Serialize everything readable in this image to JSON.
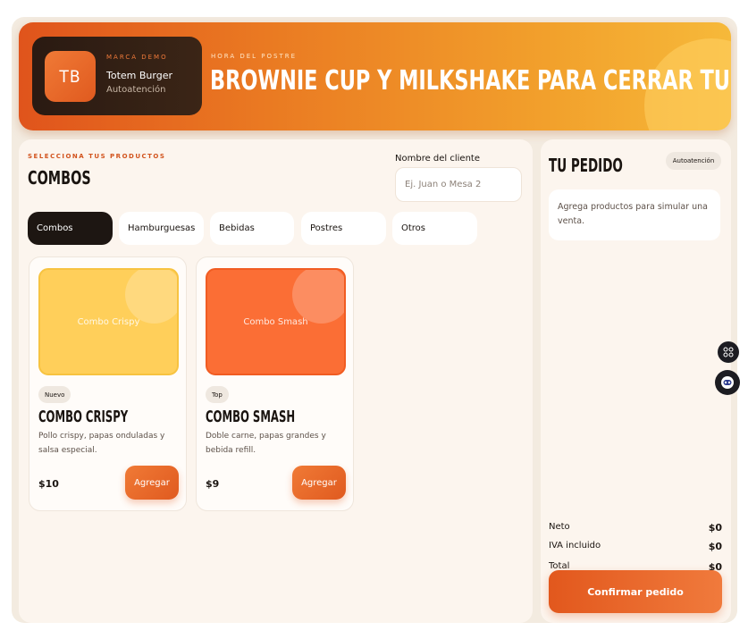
{
  "banner": {
    "brand_eyebrow": "MARCA DEMO",
    "brand_logo": "TB",
    "brand_name": "Totem Burger",
    "brand_sub": "Autoatención",
    "promo_eyebrow": "HORA DEL POSTRE",
    "promo_title": "BROWNIE CUP Y MILKSHAKE PARA CERRAR TU PEDIDO."
  },
  "products": {
    "eyebrow": "SELECCIONA TUS PRODUCTOS",
    "title": "COMBOS",
    "client_label": "Nombre del cliente",
    "client_placeholder": "Ej. Juan o Mesa 2",
    "tabs": [
      "Combos",
      "Hamburguesas",
      "Bebidas",
      "Postres",
      "Otros"
    ],
    "items": [
      {
        "image_label": "Combo Crispy",
        "badge": "Nuevo",
        "name": "COMBO CRISPY",
        "description": "Pollo crispy, papas onduladas y salsa especial.",
        "price": "$10",
        "button": "Agregar",
        "color": "#ffcf5a"
      },
      {
        "image_label": "Combo Smash",
        "badge": "Top",
        "name": "COMBO SMASH",
        "description": "Doble carne, papas grandes y bebida refill.",
        "price": "$9",
        "button": "Agregar",
        "color": "#fb6e35"
      }
    ]
  },
  "order": {
    "title": "TU PEDIDO",
    "badge": "Autoatención",
    "empty_message": "Agrega productos para simular una venta.",
    "net_label": "Neto",
    "net_value": "$0",
    "iva_label": "IVA incluido",
    "iva_value": "$0",
    "total_label": "Total",
    "total_value": "$0",
    "confirm": "Confirmar pedido"
  },
  "colors": {
    "accent": "#e05a1f",
    "dark": "#1d1612"
  }
}
